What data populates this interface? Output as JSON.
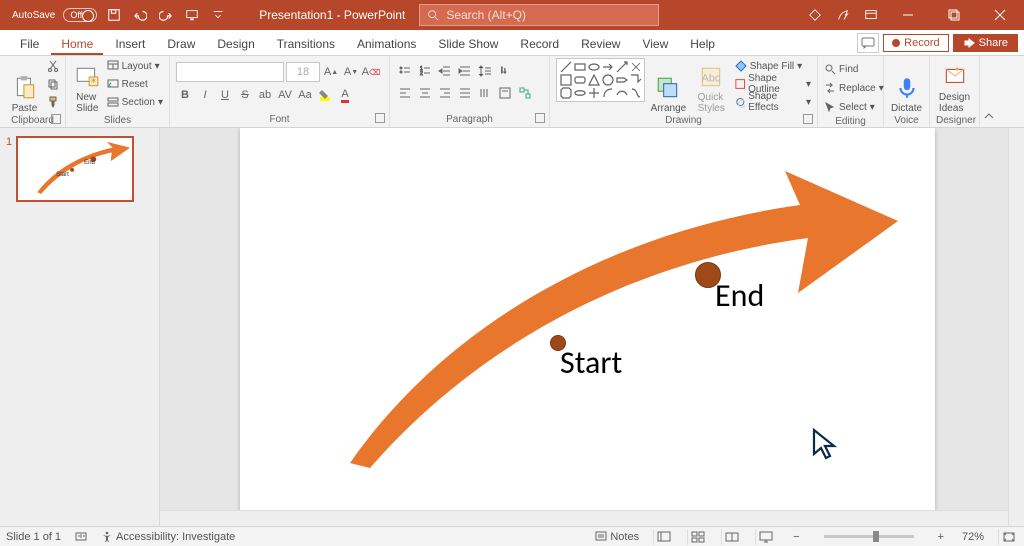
{
  "titlebar": {
    "autosave_label": "AutoSave",
    "doc_title": "Presentation1 - PowerPoint",
    "search_placeholder": "Search (Alt+Q)"
  },
  "tabs": {
    "file": "File",
    "home": "Home",
    "insert": "Insert",
    "draw": "Draw",
    "design": "Design",
    "transitions": "Transitions",
    "animations": "Animations",
    "slideshow": "Slide Show",
    "record": "Record",
    "review": "Review",
    "view": "View",
    "help": "Help",
    "record_btn": "Record",
    "share_btn": "Share"
  },
  "ribbon": {
    "clipboard": {
      "label": "Clipboard",
      "paste": "Paste"
    },
    "slides": {
      "label": "Slides",
      "new_slide": "New\nSlide",
      "layout": "Layout",
      "reset": "Reset",
      "section": "Section"
    },
    "font": {
      "label": "Font",
      "size": "18"
    },
    "paragraph": {
      "label": "Paragraph"
    },
    "drawing": {
      "label": "Drawing",
      "arrange": "Arrange",
      "quick_styles": "Quick\nStyles",
      "shape_fill": "Shape Fill",
      "shape_outline": "Shape Outline",
      "shape_effects": "Shape Effects"
    },
    "editing": {
      "label": "Editing",
      "find": "Find",
      "replace": "Replace",
      "select": "Select"
    },
    "voice": {
      "label": "Voice",
      "dictate": "Dictate"
    },
    "designer": {
      "label": "Designer",
      "design_ideas": "Design\nIdeas"
    }
  },
  "thumbnails": {
    "n1": "1"
  },
  "slide": {
    "start_label": "Start",
    "end_label": "End"
  },
  "statusbar": {
    "slide_info": "Slide 1 of 1",
    "accessibility": "Accessibility: Investigate",
    "notes": "Notes",
    "zoom": "72%"
  }
}
